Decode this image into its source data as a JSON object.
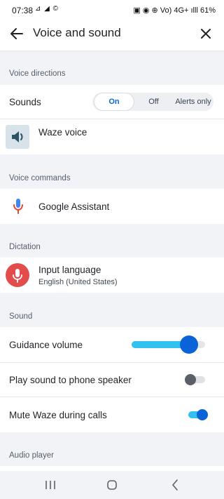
{
  "status_bar": {
    "time": "07:38",
    "left_icons": "⊿ ◢ ©",
    "right_icons": "▣ ◉ ⊕ Vo) 4G+ ılll",
    "battery": "61%"
  },
  "header": {
    "title": "Voice and sound",
    "back_icon": "arrow-left-icon",
    "close_icon": "close-icon"
  },
  "sections": {
    "voice_directions": "Voice directions",
    "voice_commands": "Voice commands",
    "dictation": "Dictation",
    "sound": "Sound",
    "audio_player": "Audio player"
  },
  "sounds": {
    "label": "Sounds",
    "options": [
      "On",
      "Off",
      "Alerts only"
    ],
    "selected": "On"
  },
  "waze_voice": {
    "label": "Waze voice",
    "icon": "speaker-icon"
  },
  "google_assistant": {
    "label": "Google Assistant",
    "icon": "microphone-icon"
  },
  "input_language": {
    "label": "Input language",
    "value": "English (United States)",
    "icon": "microphone-icon"
  },
  "guidance_volume": {
    "label": "Guidance volume",
    "level": 0.78
  },
  "phone_speaker": {
    "label": "Play sound to phone speaker",
    "enabled": false
  },
  "mute_calls": {
    "label": "Mute Waze during calls",
    "enabled": true
  },
  "colors": {
    "accent": "#0a64d8",
    "slider_fill": "#33c1f0",
    "mic_red": "#e24c4b"
  }
}
